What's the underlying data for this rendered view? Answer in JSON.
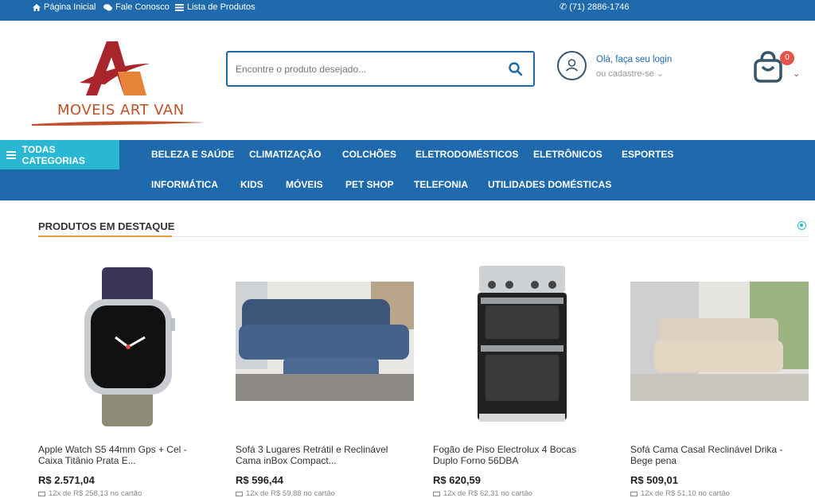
{
  "topbar": {
    "links": [
      {
        "label": "Página Inicial",
        "icon": "home-icon"
      },
      {
        "label": "Fale Conosco",
        "icon": "chat-icon"
      },
      {
        "label": "Lista de Produtos",
        "icon": "list-icon"
      }
    ],
    "phone": "(71) 2886-1746"
  },
  "logo": {
    "text": "MOVEIS ART VAN"
  },
  "search": {
    "placeholder": "Encontre o produto desejado..."
  },
  "account": {
    "line1": "Olá, faça seu login",
    "line2": "ou cadastre-se"
  },
  "cart": {
    "count": "0"
  },
  "nav": {
    "all_categories": "TODAS CATEGORIAS",
    "row1": [
      "BELEZA E SAÚDE",
      "CLIMATIZAÇÃO",
      "COLCHÕES",
      "ELETRODOMÉSTICOS",
      "ELETRÔNICOS",
      "ESPORTES"
    ],
    "row2": [
      "INFORMÁTICA",
      "KIDS",
      "MÓVEIS",
      "PET SHOP",
      "TELEFONIA",
      "UTILIDADES DOMÉSTICAS"
    ]
  },
  "section": {
    "title": "PRODUTOS EM DESTAQUE"
  },
  "products": [
    {
      "name": "Apple Watch S5 44mm Gps + Cel - Caixa Titânio Prata E...",
      "price": "R$ 2.571,04",
      "installment": "12x de R$ 258,13 no cartão"
    },
    {
      "name": "Sofá 3 Lugares Retrátil e Reclinável Cama inBox Compact...",
      "price": "R$ 596,44",
      "installment": "12x de R$ 59,88 no cartão"
    },
    {
      "name": "Fogão de Piso Electrolux 4 Bocas Duplo Forno 56DBA",
      "price": "R$ 620,59",
      "installment": "12x de R$ 62,31 no cartão"
    },
    {
      "name": "Sofá Cama Casal Reclinável Drika - Bege pena",
      "price": "R$ 509,01",
      "installment": "12x de R$ 51,10 no cartão"
    }
  ],
  "colors": {
    "primary": "#1f6aad",
    "accent": "#29b7d2",
    "underline": "#e8a13a",
    "badge": "#e5534b"
  }
}
